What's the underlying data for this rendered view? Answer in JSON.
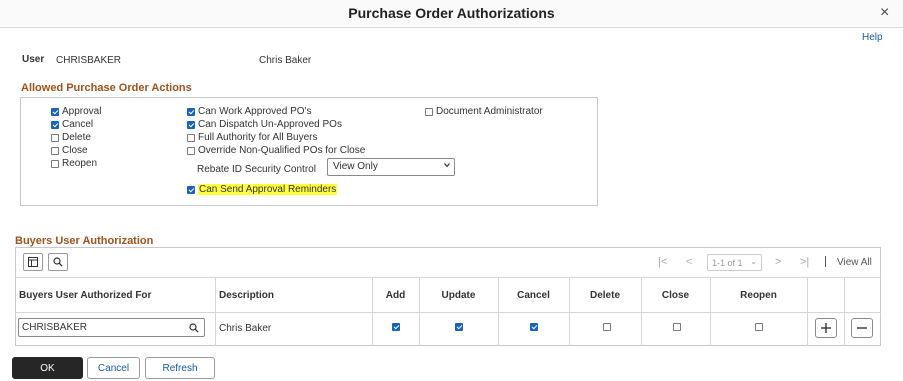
{
  "dialog": {
    "title": "Purchase Order Authorizations",
    "help_label": "Help",
    "close_glyph": "×"
  },
  "user": {
    "label": "User",
    "id": "CHRISBAKER",
    "name": "Chris Baker"
  },
  "allowed_actions": {
    "title": "Allowed Purchase Order Actions",
    "col1": [
      {
        "label": "Approval",
        "checked": true
      },
      {
        "label": "Cancel",
        "checked": true
      },
      {
        "label": "Delete",
        "checked": false
      },
      {
        "label": "Close",
        "checked": false
      },
      {
        "label": "Reopen",
        "checked": false
      }
    ],
    "col2": [
      {
        "label": "Can Work Approved PO's",
        "checked": true
      },
      {
        "label": "Can Dispatch Un-Approved POs",
        "checked": true
      },
      {
        "label": "Full Authority for All Buyers",
        "checked": false
      },
      {
        "label": "Override Non-Qualified POs for Close",
        "checked": false
      }
    ],
    "col3": [
      {
        "label": "Document Administrator",
        "checked": false
      }
    ],
    "rebate": {
      "label": "Rebate ID Security Control",
      "value": "View Only"
    },
    "reminders": {
      "label": "Can Send Approval Reminders",
      "checked": true,
      "highlight_color": "#ffff3a"
    }
  },
  "buyers": {
    "title": "Buyers User Authorization",
    "pagination": {
      "range": "1-1 of 1",
      "view_all": "View All"
    },
    "columns": [
      "Buyers User Authorized For",
      "Description",
      "Add",
      "Update",
      "Cancel",
      "Delete",
      "Close",
      "Reopen"
    ],
    "row": {
      "buyer": "CHRISBAKER",
      "description": "Chris Baker",
      "add": true,
      "update": true,
      "cancel": true,
      "delete": false,
      "close": false,
      "reopen": false
    }
  },
  "buttons": {
    "ok": "OK",
    "cancel": "Cancel",
    "refresh": "Refresh"
  },
  "colors": {
    "accent": "#1565c0",
    "section_title": "#a0521a",
    "link": "#1a5aa6"
  }
}
